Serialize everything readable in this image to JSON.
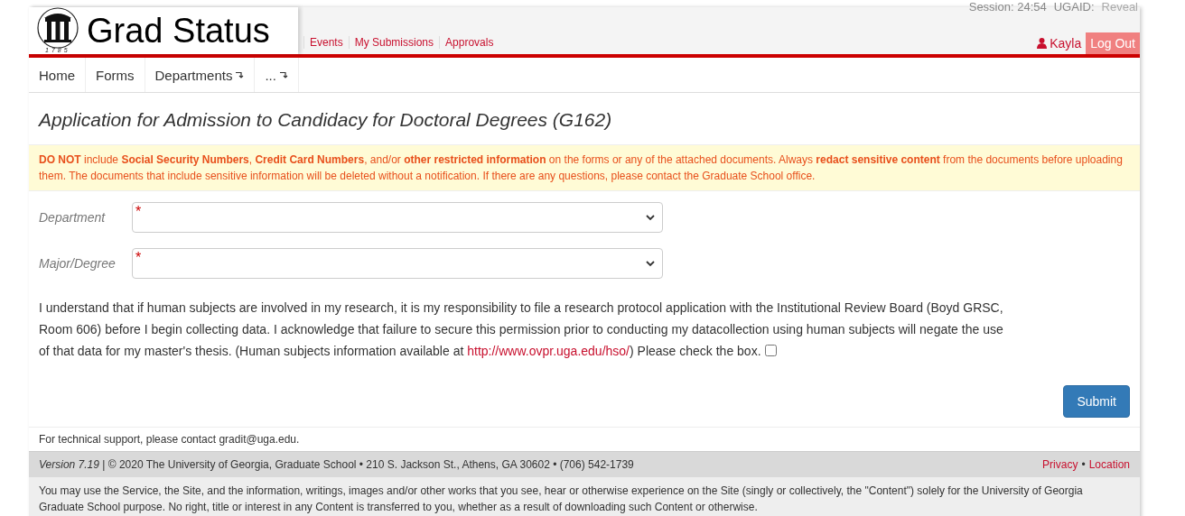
{
  "header": {
    "logo_year": "1785",
    "app_name": "Grad Status",
    "session": "Session: 24:54",
    "ugaid_label": "UGAID:",
    "reveal": "Reveal",
    "top_links": [
      {
        "label": "Events"
      },
      {
        "label": "My Submissions"
      },
      {
        "label": "Approvals"
      }
    ],
    "user": "Kayla",
    "logout": "Log Out"
  },
  "nav": [
    {
      "label": "Home",
      "dropdown": false
    },
    {
      "label": "Forms",
      "dropdown": false
    },
    {
      "label": "Departments",
      "dropdown": true
    },
    {
      "label": "...",
      "dropdown": true
    }
  ],
  "title": "Application for Admission to Candidacy for Doctoral Degrees (G162)",
  "warning": "**DO NOT** include **Social Security Numbers**, **Credit Card Numbers**, and/or **other restricted information** on the forms or any of the attached documents. Always **redact sensitive content** from the documents before uploading them. The documents that include sensitive information will be deleted without a notification. If there are any questions, please contact the Graduate School office.",
  "fields": [
    {
      "label": "Department",
      "required_mark": "*"
    },
    {
      "label": "Major/Degree",
      "required_mark": "*"
    }
  ],
  "consent": {
    "text": "I understand that if human subjects are involved in my research, it is my responsibility to file a research protocol application with the Institutional Review Board (Boyd GRSC, Room 606) before I begin collecting data. I acknowledge that failure to secure this permission prior to conducting my datacollection using human subjects will negate the use of that data for my master's thesis. (Human subjects information available at ",
    "link": "http://www.ovpr.uga.edu/hso/",
    "after": ") Please check the box.",
    "checked": false
  },
  "submit": "Submit",
  "support": "For technical support, please contact gradit@uga.edu.",
  "footer": {
    "info": "*Version 7.19* | © 2020 The University of Georgia, Graduate School • 210 S. Jackson St., Athens, GA 30602 • (706) 542-1739",
    "links": [
      "Privacy",
      "Location"
    ],
    "separator": "•"
  },
  "legal": "You may use the Service, the Site, and the information, writings, images and/or other works that you see, hear or otherwise experience on the Site (singly or collectively, the \"Content\") solely for the University of Georgia Graduate School purpose. No right, title or interest in any Content is transferred to you, whether as a result of downloading such Content or otherwise."
}
